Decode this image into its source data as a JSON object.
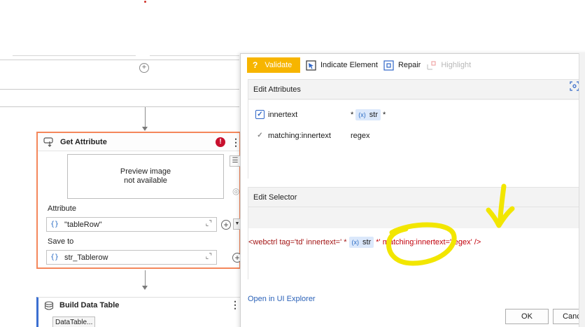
{
  "workflow": {
    "get_attribute": {
      "title": "Get Attribute",
      "error_symbol": "!",
      "preview_line1": "Preview image",
      "preview_line2": "not available",
      "attribute_label": "Attribute",
      "attribute_value": "\"tableRow\"",
      "save_to_label": "Save to",
      "save_to_value": "str_Tablerow",
      "brace": "{}"
    },
    "build_data_table": {
      "title": "Build Data Table",
      "button": "DataTable..."
    }
  },
  "dialog": {
    "toolbar": {
      "validate": "Validate",
      "indicate_element": "Indicate Element",
      "repair": "Repair",
      "highlight": "Highlight"
    },
    "edit_attributes": {
      "title": "Edit Attributes",
      "rows": [
        {
          "name": "innertext",
          "prefix": "*",
          "variable": "str",
          "suffix": "*",
          "checked": true
        },
        {
          "name": "matching:innertext",
          "value": "regex",
          "checked": true
        }
      ]
    },
    "edit_selector": {
      "title": "Edit Selector",
      "part1": "<webctrl tag='td' innertext=' *",
      "variable": "str",
      "part2": "*' matching:innertext='regex' />"
    },
    "open_in_ui_explorer": "Open in UI Explorer",
    "ok": "OK",
    "cancel": "Cance"
  },
  "colors": {
    "validate_bg": "#f7b500",
    "activity_border": "#f4875b",
    "error_red": "#c8102e",
    "link_blue": "#2b62b8",
    "annotation_yellow": "#f2e600"
  }
}
